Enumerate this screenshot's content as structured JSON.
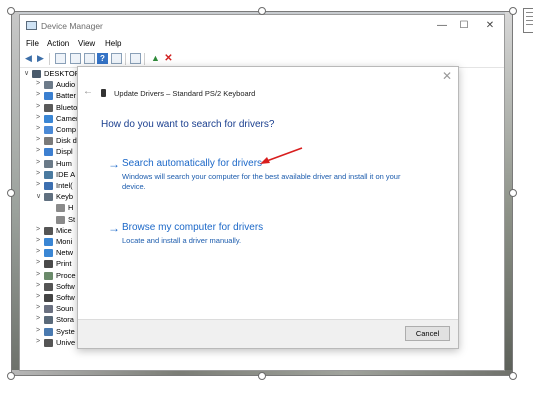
{
  "window": {
    "title": "Device Manager",
    "minimize": "—",
    "maximize": "☐",
    "close": "✕"
  },
  "menu": [
    "File",
    "Action",
    "View",
    "Help"
  ],
  "tree": [
    {
      "label": "DESKTOP",
      "expand": "∨",
      "level": 0
    },
    {
      "label": "Audio",
      "expand": ">",
      "level": 1
    },
    {
      "label": "Batter",
      "expand": ">",
      "level": 1
    },
    {
      "label": "Blueto",
      "expand": ">",
      "level": 1
    },
    {
      "label": "Camer",
      "expand": ">",
      "level": 1
    },
    {
      "label": "Comp",
      "expand": ">",
      "level": 1
    },
    {
      "label": "Disk d",
      "expand": ">",
      "level": 1
    },
    {
      "label": "Displ",
      "expand": ">",
      "level": 1
    },
    {
      "label": "Hum",
      "expand": ">",
      "level": 1
    },
    {
      "label": "IDE A",
      "expand": ">",
      "level": 1
    },
    {
      "label": "Intel(",
      "expand": ">",
      "level": 1
    },
    {
      "label": "Keyb",
      "expand": "∨",
      "level": 1
    },
    {
      "label": "H",
      "expand": "",
      "level": 2
    },
    {
      "label": "St",
      "expand": "",
      "level": 2
    },
    {
      "label": "Mice",
      "expand": ">",
      "level": 1
    },
    {
      "label": "Moni",
      "expand": ">",
      "level": 1
    },
    {
      "label": "Netw",
      "expand": ">",
      "level": 1
    },
    {
      "label": "Print",
      "expand": ">",
      "level": 1
    },
    {
      "label": "Proce",
      "expand": ">",
      "level": 1
    },
    {
      "label": "Softw",
      "expand": ">",
      "level": 1
    },
    {
      "label": "Softw",
      "expand": ">",
      "level": 1
    },
    {
      "label": "Soun",
      "expand": ">",
      "level": 1
    },
    {
      "label": "Stora",
      "expand": ">",
      "level": 1
    },
    {
      "label": "Syste",
      "expand": ">",
      "level": 1
    },
    {
      "label": "Unive",
      "expand": ">",
      "level": 1
    }
  ],
  "dialog": {
    "close": "✕",
    "back": "←",
    "header": "Update Drivers – Standard PS/2 Keyboard",
    "question": "How do you want to search for drivers?",
    "options": [
      {
        "arrow": "→",
        "title": "Search automatically for drivers",
        "description": "Windows will search your computer for the best available driver and install it on your device."
      },
      {
        "arrow": "→",
        "title": "Browse my computer for drivers",
        "description": "Locate and install a driver manually."
      }
    ],
    "cancel_label": "Cancel"
  },
  "colors": {
    "link_blue": "#1c68c8",
    "question_blue": "#1a3f8f",
    "annotation_red": "#d81e1e"
  }
}
